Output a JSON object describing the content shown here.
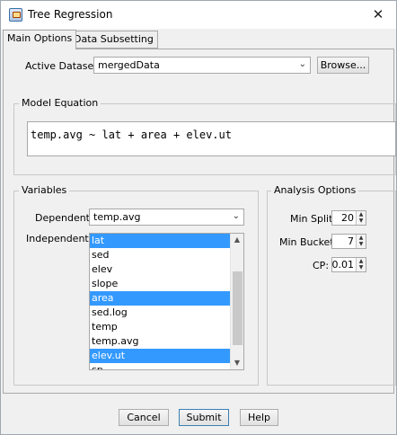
{
  "window": {
    "title": "Tree Regression",
    "close_glyph": "✕"
  },
  "tabs": [
    {
      "label": "Main Options",
      "active": true
    },
    {
      "label": "Data Subsetting",
      "active": false
    }
  ],
  "dataset": {
    "label": "Active Dataset:",
    "value": "mergedData",
    "browse_label": "Browse..."
  },
  "model": {
    "group_title": "Model Equation",
    "equation": "temp.avg ~ lat + area + elev.ut"
  },
  "variables": {
    "group_title": "Variables",
    "dependent_label": "Dependent:",
    "dependent_value": "temp.avg",
    "independent_label": "Independent:",
    "items": [
      {
        "label": "lat",
        "selected": true
      },
      {
        "label": "sed",
        "selected": false
      },
      {
        "label": "elev",
        "selected": false
      },
      {
        "label": "slope",
        "selected": false
      },
      {
        "label": "area",
        "selected": true
      },
      {
        "label": "sed.log",
        "selected": false
      },
      {
        "label": "temp",
        "selected": false
      },
      {
        "label": "temp.avg",
        "selected": false
      },
      {
        "label": "elev.ut",
        "selected": true
      },
      {
        "label": "sp",
        "selected": false
      }
    ]
  },
  "analysis": {
    "group_title": "Analysis Options",
    "min_split_label": "Min Split:",
    "min_split_value": "20",
    "min_bucket_label": "Min Bucket:",
    "min_bucket_value": "7",
    "cp_label": "CP:",
    "cp_value": "0.01"
  },
  "buttons": {
    "cancel": "Cancel",
    "submit": "Submit",
    "help": "Help"
  },
  "icons": {
    "combo_arrow": "chevron-down-icon",
    "spinner": "up-down-arrows-icon"
  },
  "colors": {
    "selection": "#3399ff",
    "panel": "#f0f0f0"
  }
}
